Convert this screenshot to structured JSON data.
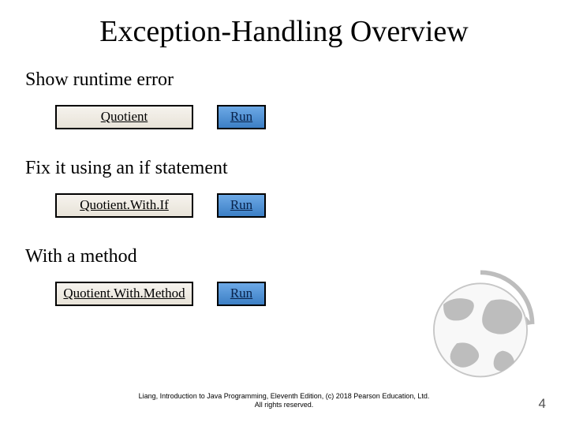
{
  "title": "Exception-Handling Overview",
  "sections": [
    {
      "heading": "Show runtime error",
      "label": "Quotient",
      "run": "Run"
    },
    {
      "heading": "Fix it using an if statement",
      "label": "Quotient.With.If",
      "run": "Run"
    },
    {
      "heading": "With a method",
      "label": "Quotient.With.Method",
      "run": "Run"
    }
  ],
  "footer": {
    "line1": "Liang, Introduction to Java Programming, Eleventh Edition, (c) 2018 Pearson Education, Ltd.",
    "line2": "All rights reserved."
  },
  "page_number": "4"
}
